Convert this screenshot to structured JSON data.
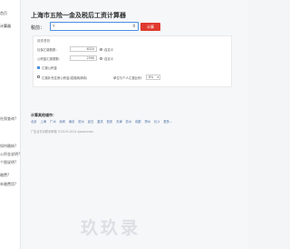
{
  "sidebar": {
    "items": [
      {
        "label": "首页"
      },
      {
        "label": "计算器"
      },
      {
        "label": "社保查询?"
      },
      {
        "label": "如何缴纳?"
      },
      {
        "label": "公积金说明?"
      },
      {
        "label": "个税说明?"
      },
      {
        "label": "缴费?"
      },
      {
        "label": "补缴费用?"
      }
    ]
  },
  "page": {
    "title": "上海市五险一金及税后工资计算器",
    "pre_tax_label": "税前：",
    "currency": "¥",
    "salary_value": "0",
    "calc_button": "计算"
  },
  "panel": {
    "header": "缴费基数",
    "social_base_label": "社保汇缴基数：",
    "social_base_value": "6520",
    "fund_base_label": "公积金汇缴基数：",
    "fund_base_value": "2590",
    "custom_label": "自定义",
    "custom_label_2": "自定义",
    "fund_checkbox_label": "汇缴公积金",
    "supplement_label": "汇缴补充住房公积金(若缴纳请填)",
    "supplement_ratio_label": "单位与个人汇缴比例：",
    "ratio_value": "8%"
  },
  "cities": {
    "title": "计算其他城市：",
    "list": [
      "北京",
      "上海",
      "广州",
      "深圳",
      "南京",
      "杭州",
      "武汉",
      "重庆",
      "西安",
      "天津",
      "苏州",
      "成都",
      "郑州",
      "长沙",
      "更多..."
    ]
  },
  "footer": {
    "copyright": "广告合作请联系邮箱 ©2019-2024 Ajaxaccess"
  },
  "watermark": "玖玖录"
}
